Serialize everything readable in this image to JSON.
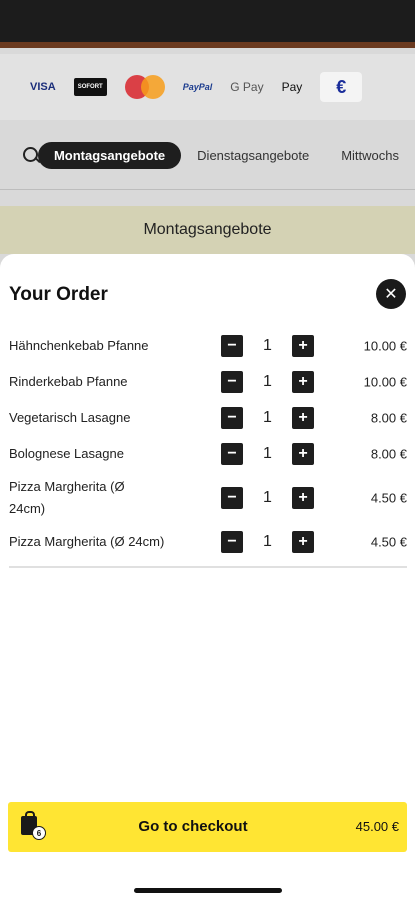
{
  "payment": {
    "visa": "VISA",
    "sofort": "SOFORT",
    "mastercard": "MasterCard",
    "paypal": "PayPal",
    "gpay": "G Pay",
    "applepay": "Pay",
    "euro": "€"
  },
  "tabs": [
    {
      "label": "Montagsangebote",
      "active": true
    },
    {
      "label": "Dienstagsangebote",
      "active": false
    },
    {
      "label": "Mittwochs",
      "active": false
    }
  ],
  "section_title": "Montagsangebote",
  "order": {
    "title": "Your Order",
    "items": [
      {
        "name": "Hähnchenkebab Pfanne",
        "qty": "1",
        "price": "10.00 €"
      },
      {
        "name": "Rinderkebab Pfanne",
        "qty": "1",
        "price": "10.00 €"
      },
      {
        "name": "Vegetarisch Lasagne",
        "qty": "1",
        "price": "8.00 €"
      },
      {
        "name": "Bolognese Lasagne",
        "qty": "1",
        "price": "8.00 €"
      },
      {
        "name": "Pizza Margherita (Ø 24cm)",
        "qty": "1",
        "price": "4.50 €"
      },
      {
        "name": "Pizza Margherita (Ø 24cm)",
        "qty": "1",
        "price": "4.50 €"
      }
    ]
  },
  "checkout": {
    "label": "Go to checkout",
    "total": "45.00 €",
    "count": "6"
  },
  "colors": {
    "accent": "#ffe533",
    "dark": "#1e1e1e"
  }
}
